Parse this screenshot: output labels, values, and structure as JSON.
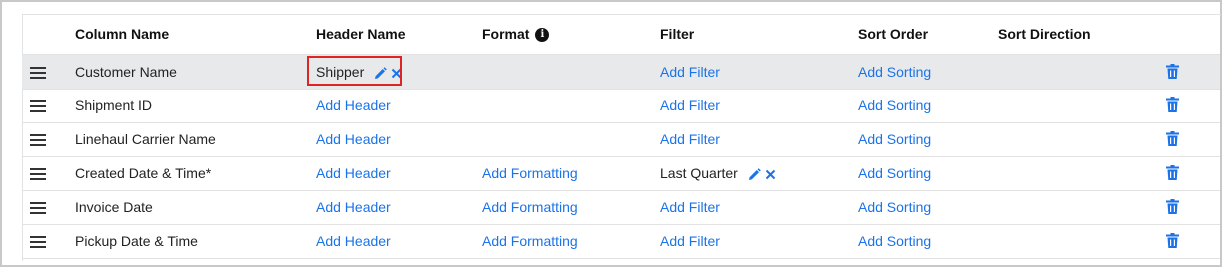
{
  "columns": {
    "column_name": "Column Name",
    "header_name": "Header Name",
    "format": "Format",
    "filter": "Filter",
    "sort_order": "Sort Order",
    "sort_direction": "Sort Direction"
  },
  "icons": {
    "drag": "drag-handle-icon",
    "info": "info-icon",
    "edit": "pencil-icon",
    "clear": "close-icon",
    "delete": "trash-icon"
  },
  "colors": {
    "link": "#1a73e8",
    "highlight": "#e02424",
    "selected_row": "#e8e9eb"
  },
  "rows": [
    {
      "name": "Customer Name",
      "header": "Shipper",
      "format": "",
      "filter": "Add Filter",
      "sort": "Add Sorting"
    },
    {
      "name": "Shipment ID",
      "header": "Add Header",
      "format": "",
      "filter": "Add Filter",
      "sort": "Add Sorting"
    },
    {
      "name": "Linehaul Carrier Name",
      "header": "Add Header",
      "format": "",
      "filter": "Add Filter",
      "sort": "Add Sorting"
    },
    {
      "name": "Created Date & Time*",
      "header": "Add Header",
      "format": "Add Formatting",
      "filter": "Last Quarter",
      "sort": "Add Sorting"
    },
    {
      "name": "Invoice Date",
      "header": "Add Header",
      "format": "Add Formatting",
      "filter": "Add Filter",
      "sort": "Add Sorting"
    },
    {
      "name": "Pickup Date & Time",
      "header": "Add Header",
      "format": "Add Formatting",
      "filter": "Add Filter",
      "sort": "Add Sorting"
    }
  ]
}
